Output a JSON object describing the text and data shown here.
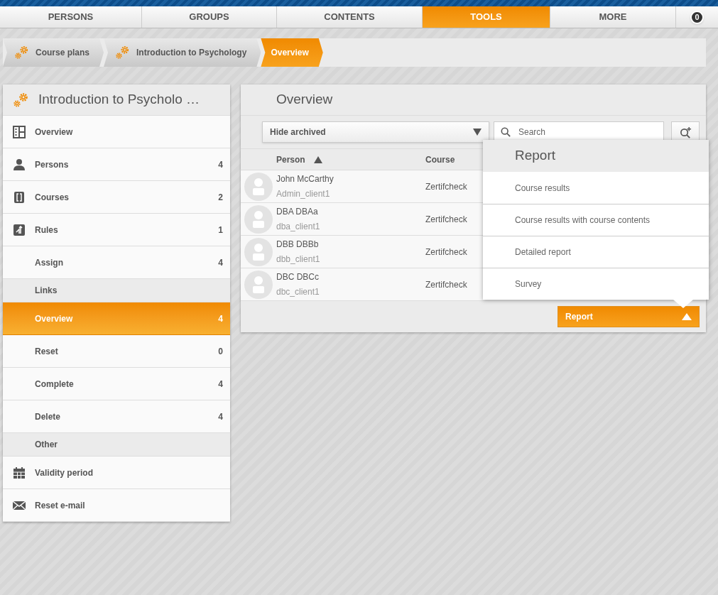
{
  "top_nav": {
    "tabs": [
      {
        "label": "PERSONS",
        "selected": false
      },
      {
        "label": "GROUPS",
        "selected": false
      },
      {
        "label": "CONTENTS",
        "selected": false
      },
      {
        "label": "TOOLS",
        "selected": true
      },
      {
        "label": "MORE",
        "selected": false
      }
    ],
    "badge": "0"
  },
  "breadcrumb": [
    {
      "label": "Course plans",
      "selected": false
    },
    {
      "label": "Introduction to Psychology",
      "selected": false
    },
    {
      "label": "Overview",
      "selected": true
    }
  ],
  "sidebar": {
    "title": "Introduction to Psycholo …",
    "items": [
      {
        "kind": "item",
        "label": "Overview",
        "selected": false
      },
      {
        "kind": "item",
        "label": "Persons",
        "count": "4",
        "selected": false
      },
      {
        "kind": "item",
        "label": "Courses",
        "count": "2",
        "selected": false
      },
      {
        "kind": "item",
        "label": "Rules",
        "count": "1",
        "selected": false
      },
      {
        "kind": "item",
        "label": "Assign",
        "count": "4",
        "selected": false
      },
      {
        "kind": "section",
        "label": "Links"
      },
      {
        "kind": "item",
        "label": "Overview",
        "count": "4",
        "selected": true
      },
      {
        "kind": "item",
        "label": "Reset",
        "count": "0",
        "selected": false
      },
      {
        "kind": "item",
        "label": "Complete",
        "count": "4",
        "selected": false
      },
      {
        "kind": "item",
        "label": "Delete",
        "count": "4",
        "selected": false
      },
      {
        "kind": "section",
        "label": "Other"
      },
      {
        "kind": "item",
        "label": "Validity period",
        "selected": false
      },
      {
        "kind": "item",
        "label": "Reset e-mail",
        "selected": false
      }
    ]
  },
  "main": {
    "title": "Overview",
    "filter": "Hide archived",
    "search": {
      "placeholder": "Search"
    },
    "table": {
      "columns": [
        "Person",
        "Course"
      ],
      "rows": [
        {
          "name": "John McCarthy",
          "login": "Admin_client1",
          "course": "Zertifcheck"
        },
        {
          "name": "DBA DBAa",
          "login": "dba_client1",
          "course": "Zertifcheck"
        },
        {
          "name": "DBB DBBb",
          "login": "dbb_client1",
          "course": "Zertifcheck"
        },
        {
          "name": "DBC DBCc",
          "login": "dbc_client1",
          "course": "Zertifcheck"
        }
      ]
    },
    "report_button": "Report",
    "report_menu": {
      "title": "Report",
      "items": [
        "Course results",
        "Course results with course contents",
        "Detailed report",
        "Survey"
      ]
    }
  }
}
